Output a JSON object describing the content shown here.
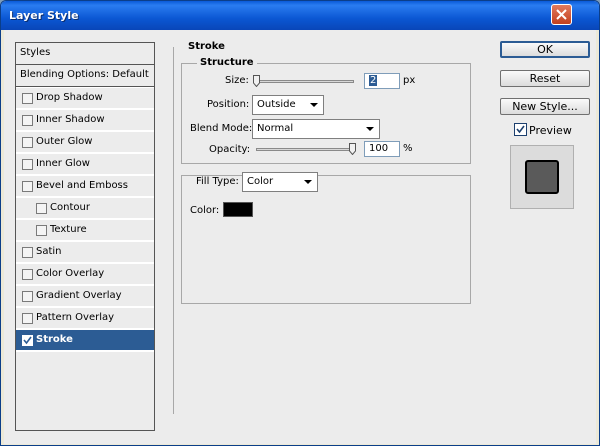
{
  "window": {
    "title": "Layer Style"
  },
  "left_panel": {
    "header": "Styles",
    "blending": "Blending Options: Default",
    "items": [
      {
        "label": "Drop Shadow",
        "checked": false,
        "indent": false
      },
      {
        "label": "Inner Shadow",
        "checked": false,
        "indent": false
      },
      {
        "label": "Outer Glow",
        "checked": false,
        "indent": false
      },
      {
        "label": "Inner Glow",
        "checked": false,
        "indent": false
      },
      {
        "label": "Bevel and Emboss",
        "checked": false,
        "indent": false
      },
      {
        "label": "Contour",
        "checked": false,
        "indent": true
      },
      {
        "label": "Texture",
        "checked": false,
        "indent": true
      },
      {
        "label": "Satin",
        "checked": false,
        "indent": false
      },
      {
        "label": "Color Overlay",
        "checked": false,
        "indent": false
      },
      {
        "label": "Gradient Overlay",
        "checked": false,
        "indent": false
      },
      {
        "label": "Pattern Overlay",
        "checked": false,
        "indent": false
      },
      {
        "label": "Stroke",
        "checked": true,
        "indent": false,
        "selected": true
      }
    ]
  },
  "stroke": {
    "title": "Stroke",
    "structure": {
      "title": "Structure",
      "size_label": "Size:",
      "size_value": "2",
      "size_unit": "px",
      "position_label": "Position:",
      "position_value": "Outside",
      "blend_mode_label": "Blend Mode:",
      "blend_mode_value": "Normal",
      "opacity_label": "Opacity:",
      "opacity_value": "100",
      "opacity_unit": "%"
    },
    "fill": {
      "fill_type_label": "Fill Type:",
      "fill_type_value": "Color",
      "color_label": "Color:",
      "color_value": "#000000"
    }
  },
  "buttons": {
    "ok": "OK",
    "reset": "Reset",
    "new_style": "New Style...",
    "preview_label": "Preview",
    "preview_checked": true
  },
  "colors": {
    "selected_row": "#2c5c94",
    "title_bar": "#0a5ad8"
  }
}
